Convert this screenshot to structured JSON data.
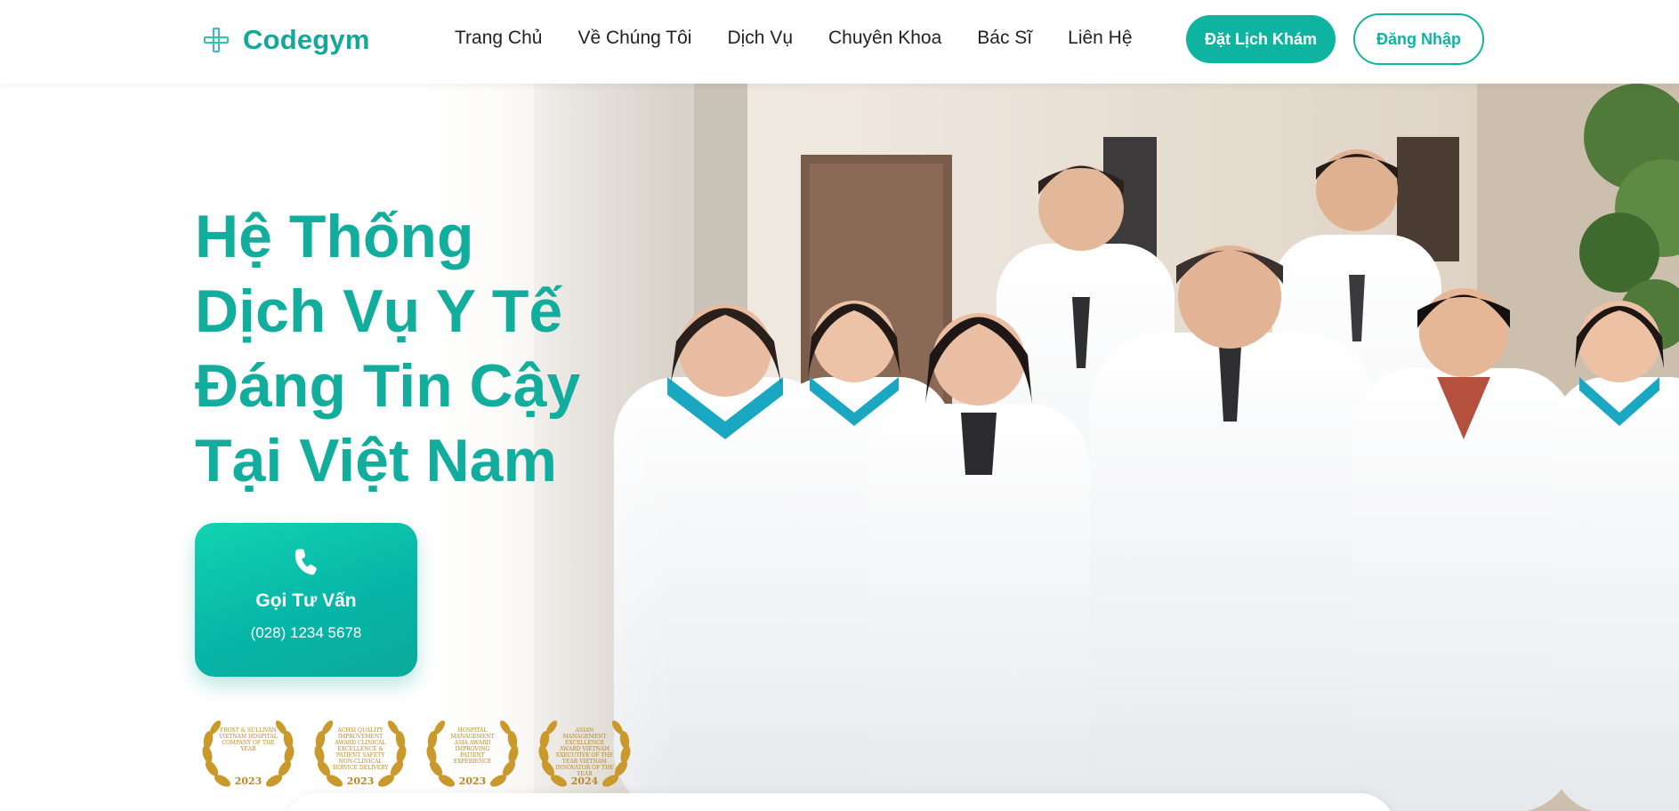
{
  "header": {
    "logo_text": "Codegym",
    "nav": [
      "Trang Chủ",
      "Về Chúng Tôi",
      "Dịch Vụ",
      "Chuyên Khoa",
      "Bác Sĩ",
      "Liên Hệ"
    ],
    "book_button": "Đặt Lịch Khám",
    "login_button": "Đăng Nhập"
  },
  "hero": {
    "title_lines": [
      "Hệ Thống",
      "Dịch Vụ Y Tế",
      "Đáng Tin Cậy",
      "Tại Việt Nam"
    ],
    "call": {
      "icon": "phone-icon",
      "label": "Gọi Tư Vấn",
      "phone": "(028) 1234 5678"
    },
    "awards": [
      {
        "text": "FROST & SULLIVAN VIETNAM HOSPITAL COMPANY OF THE YEAR",
        "year": "2023"
      },
      {
        "text": "ACHSI QUALITY IMPROVEMENT AWARD CLINICAL EXCELLENCE & PATIENT SAFETY NON-CLINICAL SERVICE DELIVERY",
        "year": "2023"
      },
      {
        "text": "HOSPITAL MANAGEMENT ASIA AWARD IMPROVING PATIENT EXPERIENCE",
        "year": "2023"
      },
      {
        "text": "ASIAN MANAGEMENT EXCELLENCE AWARD VIETNAM EXECUTIVE OF THE YEAR VIETNAM INNOVATOR OF THE YEAR",
        "year": "2024"
      }
    ]
  },
  "colors": {
    "brand": "#0fb4a1",
    "title": "#12ad9c",
    "award_gold": "#c9992c"
  }
}
